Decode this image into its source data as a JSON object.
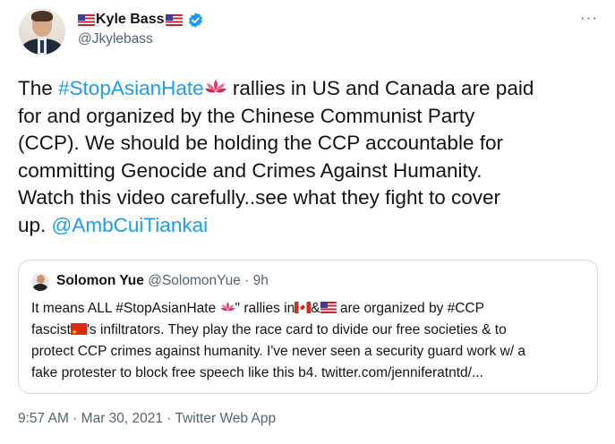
{
  "author": {
    "display_name": "Kyle Bass",
    "handle": "@Jkylebass",
    "verified_icon": "verified-badge-icon",
    "more_label": "···"
  },
  "tweet": {
    "lines": [
      {
        "before": "The ",
        "hashtag": "#StopAsianHate",
        "after": " rallies in US and Canada are paid"
      },
      {
        "text": "for and organized by the Chinese Communist Party"
      },
      {
        "text": "(CCP).  We should be holding the CCP accountable for"
      },
      {
        "text": "committing Genocide and Crimes Against Humanity."
      },
      {
        "text": "Watch this video carefully..see what they fight to cover"
      },
      {
        "before": "up. ",
        "mention": "@AmbCuiTiankai"
      }
    ]
  },
  "quote": {
    "name": "Solomon Yue",
    "handle": "@SolomonYue",
    "separator": " · ",
    "time": "9h",
    "lines": {
      "l1_a": "It means ALL #StopAsianHate ",
      "l1_b": "\" rallies in",
      "l1_c": "&",
      "l1_d": " are organized by #CCP",
      "l2_a": "fascist",
      "l2_b": "'s infiltrators. They play the race card to divide our free societies & to",
      "l3": "protect CCP crimes against humanity. I've never seen a security guard work w/ a",
      "l4": "fake protester to block free speech like this b4. twitter.com/jenniferatntd/..."
    }
  },
  "footer": {
    "time": "9:57 AM",
    "dot1": " · ",
    "date": "Mar 30, 2021",
    "dot2": " · ",
    "source": "Twitter Web App"
  },
  "colors": {
    "link": "#1d9bf0",
    "text": "#0f1419",
    "secondary": "#536471",
    "border": "#cfd9de",
    "verified": "#1d9bf0"
  },
  "icons": [
    "lotus-emoji-icon",
    "us-flag-icon",
    "canada-flag-icon",
    "china-flag-icon",
    "more-options-icon"
  ]
}
